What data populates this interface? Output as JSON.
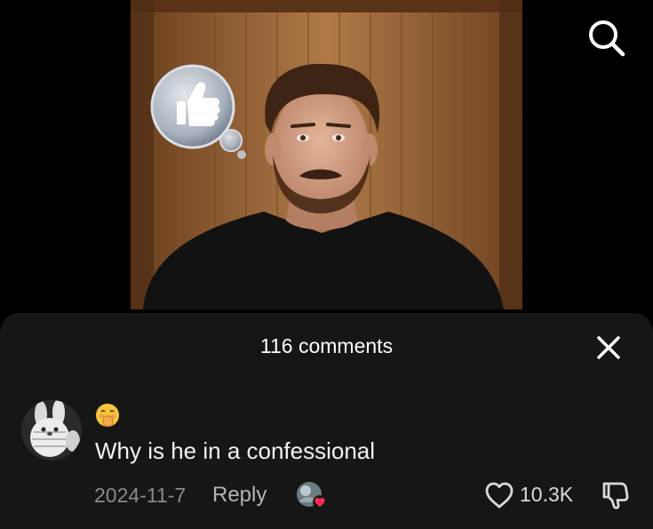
{
  "video": {
    "overlay_icon": "thumbs-up-bubble-icon",
    "subject": "person-on-camera"
  },
  "top_bar": {
    "search_icon": "search-icon"
  },
  "comments_panel": {
    "title": "116 comments",
    "close_icon": "close-icon",
    "comments": [
      {
        "avatar_icon": "plush-bunny-avatar",
        "emoji_icon": "hand-over-mouth-emoji",
        "text": "Why is he in a confessional",
        "date": "2024-11-7",
        "reply_label": "Reply",
        "reactor_icon": "creator-liked-avatar-icon",
        "like_icon": "heart-outline-icon",
        "like_count": "10.3K",
        "dislike_icon": "thumbs-down-outline-icon"
      }
    ]
  },
  "colors": {
    "background": "#000000",
    "sheet": "#161616",
    "primary_text": "#ffffff",
    "secondary_text": "#8a8a8a",
    "like_heart_accent": "#fe2c55"
  }
}
